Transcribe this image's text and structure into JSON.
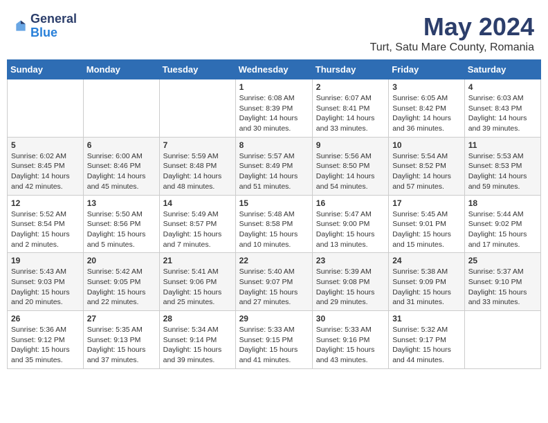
{
  "header": {
    "logo_general": "General",
    "logo_blue": "Blue",
    "title": "May 2024",
    "subtitle": "Turt, Satu Mare County, Romania"
  },
  "weekdays": [
    "Sunday",
    "Monday",
    "Tuesday",
    "Wednesday",
    "Thursday",
    "Friday",
    "Saturday"
  ],
  "weeks": [
    [
      {
        "day": "",
        "info": ""
      },
      {
        "day": "",
        "info": ""
      },
      {
        "day": "",
        "info": ""
      },
      {
        "day": "1",
        "info": "Sunrise: 6:08 AM\nSunset: 8:39 PM\nDaylight: 14 hours\nand 30 minutes."
      },
      {
        "day": "2",
        "info": "Sunrise: 6:07 AM\nSunset: 8:41 PM\nDaylight: 14 hours\nand 33 minutes."
      },
      {
        "day": "3",
        "info": "Sunrise: 6:05 AM\nSunset: 8:42 PM\nDaylight: 14 hours\nand 36 minutes."
      },
      {
        "day": "4",
        "info": "Sunrise: 6:03 AM\nSunset: 8:43 PM\nDaylight: 14 hours\nand 39 minutes."
      }
    ],
    [
      {
        "day": "5",
        "info": "Sunrise: 6:02 AM\nSunset: 8:45 PM\nDaylight: 14 hours\nand 42 minutes."
      },
      {
        "day": "6",
        "info": "Sunrise: 6:00 AM\nSunset: 8:46 PM\nDaylight: 14 hours\nand 45 minutes."
      },
      {
        "day": "7",
        "info": "Sunrise: 5:59 AM\nSunset: 8:48 PM\nDaylight: 14 hours\nand 48 minutes."
      },
      {
        "day": "8",
        "info": "Sunrise: 5:57 AM\nSunset: 8:49 PM\nDaylight: 14 hours\nand 51 minutes."
      },
      {
        "day": "9",
        "info": "Sunrise: 5:56 AM\nSunset: 8:50 PM\nDaylight: 14 hours\nand 54 minutes."
      },
      {
        "day": "10",
        "info": "Sunrise: 5:54 AM\nSunset: 8:52 PM\nDaylight: 14 hours\nand 57 minutes."
      },
      {
        "day": "11",
        "info": "Sunrise: 5:53 AM\nSunset: 8:53 PM\nDaylight: 14 hours\nand 59 minutes."
      }
    ],
    [
      {
        "day": "12",
        "info": "Sunrise: 5:52 AM\nSunset: 8:54 PM\nDaylight: 15 hours\nand 2 minutes."
      },
      {
        "day": "13",
        "info": "Sunrise: 5:50 AM\nSunset: 8:56 PM\nDaylight: 15 hours\nand 5 minutes."
      },
      {
        "day": "14",
        "info": "Sunrise: 5:49 AM\nSunset: 8:57 PM\nDaylight: 15 hours\nand 7 minutes."
      },
      {
        "day": "15",
        "info": "Sunrise: 5:48 AM\nSunset: 8:58 PM\nDaylight: 15 hours\nand 10 minutes."
      },
      {
        "day": "16",
        "info": "Sunrise: 5:47 AM\nSunset: 9:00 PM\nDaylight: 15 hours\nand 13 minutes."
      },
      {
        "day": "17",
        "info": "Sunrise: 5:45 AM\nSunset: 9:01 PM\nDaylight: 15 hours\nand 15 minutes."
      },
      {
        "day": "18",
        "info": "Sunrise: 5:44 AM\nSunset: 9:02 PM\nDaylight: 15 hours\nand 17 minutes."
      }
    ],
    [
      {
        "day": "19",
        "info": "Sunrise: 5:43 AM\nSunset: 9:03 PM\nDaylight: 15 hours\nand 20 minutes."
      },
      {
        "day": "20",
        "info": "Sunrise: 5:42 AM\nSunset: 9:05 PM\nDaylight: 15 hours\nand 22 minutes."
      },
      {
        "day": "21",
        "info": "Sunrise: 5:41 AM\nSunset: 9:06 PM\nDaylight: 15 hours\nand 25 minutes."
      },
      {
        "day": "22",
        "info": "Sunrise: 5:40 AM\nSunset: 9:07 PM\nDaylight: 15 hours\nand 27 minutes."
      },
      {
        "day": "23",
        "info": "Sunrise: 5:39 AM\nSunset: 9:08 PM\nDaylight: 15 hours\nand 29 minutes."
      },
      {
        "day": "24",
        "info": "Sunrise: 5:38 AM\nSunset: 9:09 PM\nDaylight: 15 hours\nand 31 minutes."
      },
      {
        "day": "25",
        "info": "Sunrise: 5:37 AM\nSunset: 9:10 PM\nDaylight: 15 hours\nand 33 minutes."
      }
    ],
    [
      {
        "day": "26",
        "info": "Sunrise: 5:36 AM\nSunset: 9:12 PM\nDaylight: 15 hours\nand 35 minutes."
      },
      {
        "day": "27",
        "info": "Sunrise: 5:35 AM\nSunset: 9:13 PM\nDaylight: 15 hours\nand 37 minutes."
      },
      {
        "day": "28",
        "info": "Sunrise: 5:34 AM\nSunset: 9:14 PM\nDaylight: 15 hours\nand 39 minutes."
      },
      {
        "day": "29",
        "info": "Sunrise: 5:33 AM\nSunset: 9:15 PM\nDaylight: 15 hours\nand 41 minutes."
      },
      {
        "day": "30",
        "info": "Sunrise: 5:33 AM\nSunset: 9:16 PM\nDaylight: 15 hours\nand 43 minutes."
      },
      {
        "day": "31",
        "info": "Sunrise: 5:32 AM\nSunset: 9:17 PM\nDaylight: 15 hours\nand 44 minutes."
      },
      {
        "day": "",
        "info": ""
      }
    ]
  ]
}
